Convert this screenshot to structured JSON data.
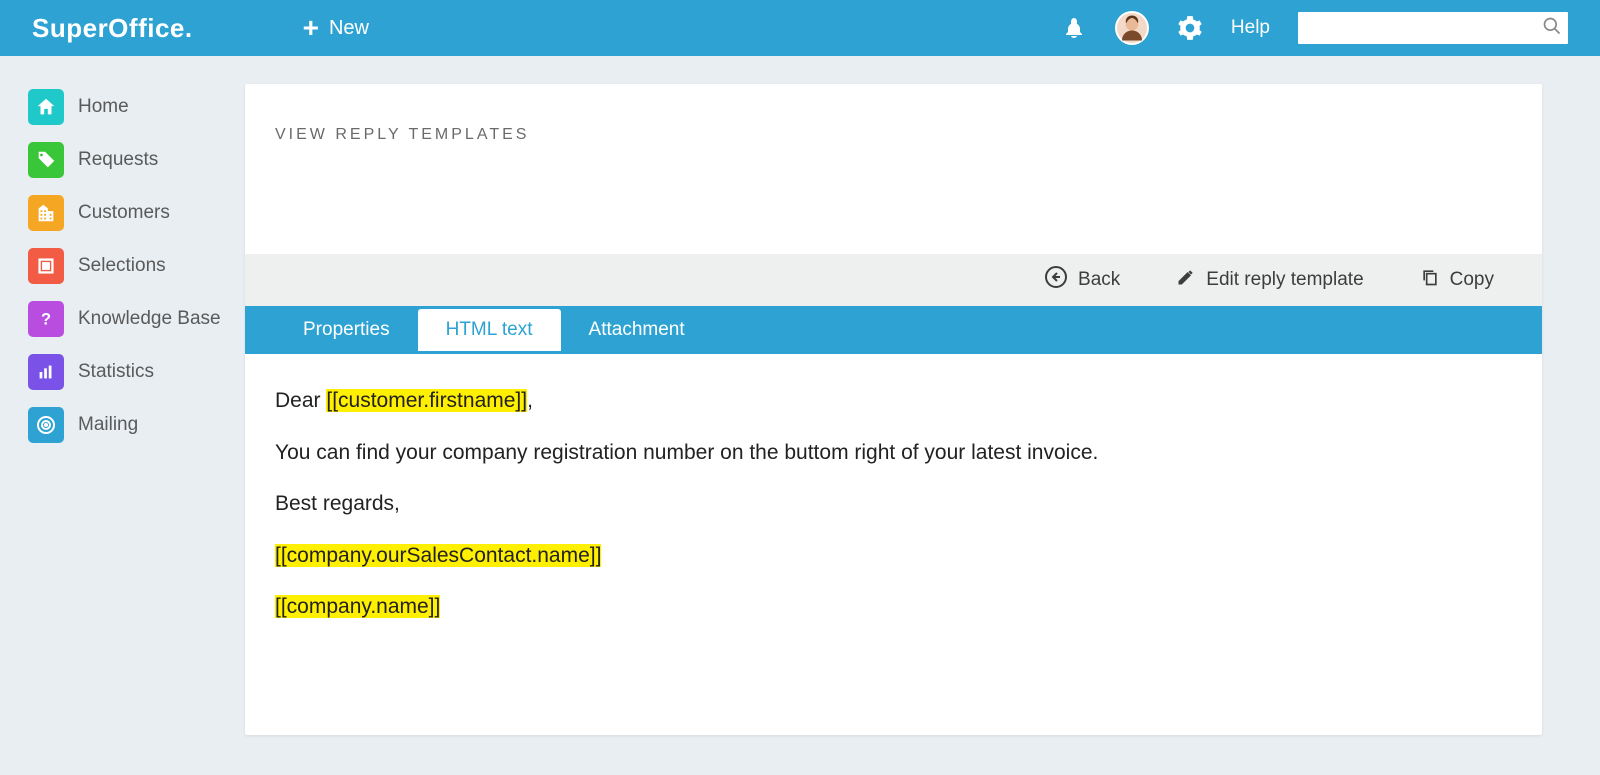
{
  "header": {
    "logo_text": "SuperOffice",
    "logo_dot": ".",
    "new_label": "New",
    "help_label": "Help",
    "search_placeholder": ""
  },
  "sidebar": {
    "items": [
      {
        "label": "Home"
      },
      {
        "label": "Requests"
      },
      {
        "label": "Customers"
      },
      {
        "label": "Selections"
      },
      {
        "label": "Knowledge Base"
      },
      {
        "label": "Statistics"
      },
      {
        "label": "Mailing"
      }
    ]
  },
  "page": {
    "title": "VIEW REPLY TEMPLATES"
  },
  "actions": {
    "back": "Back",
    "edit": "Edit reply template",
    "copy": "Copy"
  },
  "tabs": {
    "properties": "Properties",
    "html_text": "HTML text",
    "attachment": "Attachment",
    "active": "html_text"
  },
  "template_body": {
    "line1_prefix": "Dear ",
    "line1_var": "[[customer.firstname]]",
    "line1_suffix": ",",
    "line2": "You can find your company registration number on the buttom right of your latest invoice.",
    "line3": "Best regards,",
    "line4_var": "[[company.ourSalesContact.name]]",
    "line5_var": "[[company.name]]"
  }
}
